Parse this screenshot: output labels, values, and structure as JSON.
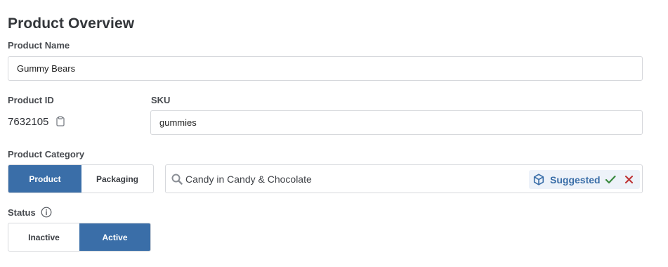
{
  "page": {
    "title": "Product Overview"
  },
  "product_name": {
    "label": "Product Name",
    "value": "Gummy Bears"
  },
  "product_id": {
    "label": "Product ID",
    "value": "7632105",
    "copy_icon": "clipboard-icon"
  },
  "sku": {
    "label": "SKU",
    "value": "gummies"
  },
  "product_category": {
    "label": "Product Category",
    "type_options": [
      {
        "label": "Product",
        "selected": true
      },
      {
        "label": "Packaging",
        "selected": false
      }
    ],
    "search_icon": "search-icon",
    "value": "Candy in Candy & Chocolate",
    "suggestion": {
      "icon": "cube-icon",
      "label": "Suggested",
      "accept_icon": "check-icon",
      "reject_icon": "close-icon"
    }
  },
  "status": {
    "label": "Status",
    "info_icon": "info-icon",
    "options": [
      {
        "label": "Inactive",
        "selected": false
      },
      {
        "label": "Active",
        "selected": true
      }
    ]
  },
  "colors": {
    "accent": "#3a6ea8",
    "accept": "#3a8a3f",
    "reject": "#c0393b",
    "suggested_bg": "#edf2f9"
  }
}
